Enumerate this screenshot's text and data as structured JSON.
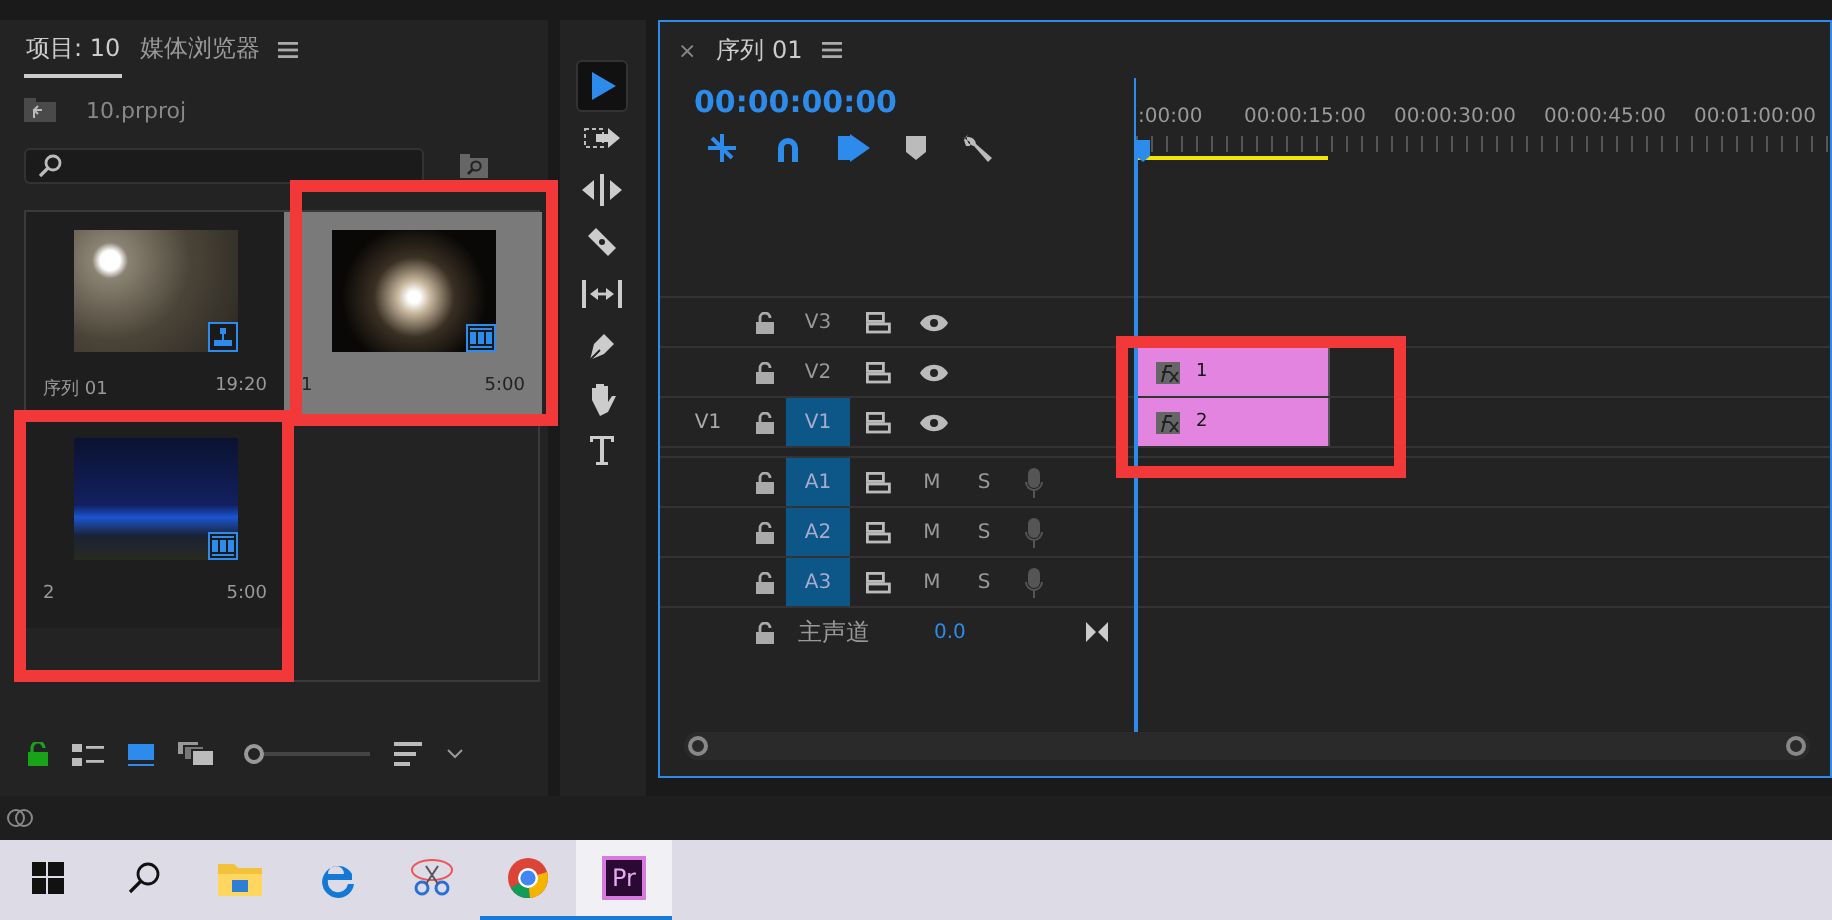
{
  "project_panel": {
    "tabs": [
      {
        "label": "项目: 10",
        "selected": true
      },
      {
        "label": "媒体浏览器",
        "selected": false
      }
    ],
    "project_file": "10.prproj",
    "zoom": {
      "level": 0.05
    },
    "items": [
      {
        "name": "序列 01",
        "duration": "19:20",
        "kind": "sequence",
        "selected": false
      },
      {
        "name": "1",
        "duration": "5:00",
        "kind": "clip",
        "selected": true
      },
      {
        "name": "2",
        "duration": "5:00",
        "kind": "clip",
        "selected": false
      }
    ]
  },
  "tools": [
    {
      "kind": "selection",
      "selected": true
    },
    {
      "kind": "track-select",
      "selected": false
    },
    {
      "kind": "ripple",
      "selected": false
    },
    {
      "kind": "razor",
      "selected": false
    },
    {
      "kind": "slip",
      "selected": false
    },
    {
      "kind": "pen",
      "selected": false
    },
    {
      "kind": "hand",
      "selected": false
    },
    {
      "kind": "type",
      "selected": false
    }
  ],
  "timeline": {
    "close": "×",
    "tab": "序列 01",
    "timecode": "00:00:00:00",
    "ruler": [
      ":00:00",
      "00:00:15:00",
      "00:00:30:00",
      "00:00:45:00",
      "00:01:00:00"
    ],
    "video_tracks": [
      {
        "name": "V3",
        "targeted": false
      },
      {
        "name": "V2",
        "targeted": false,
        "clip": "1"
      },
      {
        "source": "V1",
        "name": "V1",
        "targeted": true,
        "clip": "2"
      }
    ],
    "audio_tracks": [
      {
        "name": "A1",
        "targeted": true,
        "mute": "M",
        "solo": "S"
      },
      {
        "name": "A2",
        "targeted": true,
        "mute": "M",
        "solo": "S"
      },
      {
        "name": "A3",
        "targeted": true,
        "mute": "M",
        "solo": "S"
      }
    ],
    "master": {
      "label": "主声道",
      "value": "0.0"
    }
  },
  "taskbar": [
    {
      "kind": "start",
      "running": false,
      "selected": false
    },
    {
      "kind": "search",
      "running": false,
      "selected": false
    },
    {
      "kind": "explorer",
      "running": false,
      "selected": false
    },
    {
      "kind": "edge",
      "running": false,
      "selected": false
    },
    {
      "kind": "snip",
      "running": false,
      "selected": false
    },
    {
      "kind": "chrome",
      "running": true,
      "selected": false
    },
    {
      "kind": "premiere",
      "label": "Pr",
      "running": true,
      "selected": true
    }
  ]
}
